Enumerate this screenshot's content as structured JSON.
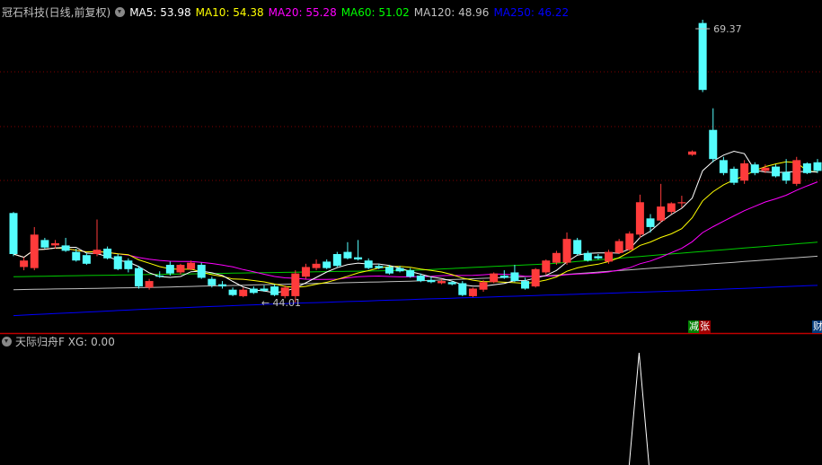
{
  "header": {
    "title": "冠石科技(日线,前复权)",
    "ma": [
      {
        "label": "MA5: 53.98",
        "color": "#ffffff"
      },
      {
        "label": "MA10: 54.38",
        "color": "#ffff00"
      },
      {
        "label": "MA20: 55.28",
        "color": "#ff00ff"
      },
      {
        "label": "MA60: 51.02",
        "color": "#00ff00"
      },
      {
        "label": "MA120: 48.96",
        "color": "#c0c0c0"
      },
      {
        "label": "MA250: 46.22",
        "color": "#0000ff"
      }
    ]
  },
  "price_axis": {
    "high": 69.37,
    "low": 44.01
  },
  "annotations": {
    "high_label": "69.37",
    "low_label": "← 44.01"
  },
  "colors": {
    "up": "#ff3b3b",
    "down": "#54fcfc",
    "grid": "#800000",
    "separator": "#c00000"
  },
  "candles": [
    [
      52.3,
      52.4,
      48.3,
      48.5
    ],
    [
      47.3,
      48.2,
      47.0,
      47.9
    ],
    [
      47.2,
      51.0,
      47.0,
      50.3
    ],
    [
      49.8,
      50.0,
      49.0,
      49.1
    ],
    [
      49.3,
      49.8,
      49.0,
      49.5
    ],
    [
      49.3,
      50.0,
      48.7,
      48.8
    ],
    [
      48.7,
      49.0,
      47.8,
      47.9
    ],
    [
      48.4,
      48.6,
      47.5,
      47.6
    ],
    [
      48.5,
      51.7,
      48.3,
      48.9
    ],
    [
      49.0,
      49.2,
      48.0,
      48.1
    ],
    [
      48.3,
      48.5,
      47.0,
      47.1
    ],
    [
      47.9,
      48.1,
      46.8,
      47.1
    ],
    [
      47.2,
      47.4,
      45.3,
      45.5
    ],
    [
      45.4,
      46.2,
      45.2,
      46.0
    ],
    [
      46.5,
      46.9,
      46.3,
      46.4
    ],
    [
      47.5,
      47.8,
      46.5,
      46.7
    ],
    [
      46.8,
      47.6,
      46.6,
      47.5
    ],
    [
      47.1,
      47.9,
      47.0,
      47.7
    ],
    [
      47.5,
      47.7,
      46.2,
      46.3
    ],
    [
      46.2,
      46.4,
      45.4,
      45.6
    ],
    [
      45.7,
      46.0,
      45.3,
      45.5
    ],
    [
      45.2,
      45.4,
      44.6,
      44.7
    ],
    [
      44.6,
      45.4,
      44.5,
      45.2
    ],
    [
      45.3,
      45.5,
      44.8,
      44.9
    ],
    [
      45.3,
      45.6,
      45.0,
      45.1
    ],
    [
      45.5,
      45.7,
      44.6,
      44.7
    ],
    [
      44.6,
      45.6,
      44.4,
      45.4
    ],
    [
      44.6,
      47.0,
      44.0,
      46.7
    ],
    [
      46.4,
      47.6,
      46.2,
      47.3
    ],
    [
      47.2,
      48.0,
      47.0,
      47.6
    ],
    [
      47.8,
      48.0,
      47.1,
      47.2
    ],
    [
      48.5,
      48.7,
      47.3,
      47.4
    ],
    [
      48.7,
      49.6,
      48.0,
      48.1
    ],
    [
      48.2,
      49.8,
      47.9,
      48.0
    ],
    [
      47.9,
      48.1,
      47.1,
      47.2
    ],
    [
      47.4,
      47.6,
      47.1,
      47.2
    ],
    [
      47.3,
      47.5,
      46.6,
      46.7
    ],
    [
      47.2,
      47.4,
      46.8,
      46.9
    ],
    [
      47.0,
      47.2,
      46.3,
      46.4
    ],
    [
      46.5,
      46.7,
      45.9,
      46.0
    ],
    [
      46.1,
      46.4,
      45.8,
      45.9
    ],
    [
      45.8,
      46.2,
      45.7,
      46.0
    ],
    [
      45.9,
      46.0,
      45.6,
      45.7
    ],
    [
      45.8,
      46.0,
      44.6,
      44.7
    ],
    [
      44.6,
      45.4,
      44.5,
      45.3
    ],
    [
      45.2,
      46.1,
      45.0,
      45.9
    ],
    [
      45.9,
      46.8,
      45.8,
      46.7
    ],
    [
      46.5,
      47.0,
      46.2,
      46.3
    ],
    [
      46.8,
      47.5,
      45.9,
      46.0
    ],
    [
      46.0,
      46.3,
      45.2,
      45.3
    ],
    [
      45.5,
      47.2,
      45.4,
      47.1
    ],
    [
      46.8,
      48.0,
      46.6,
      47.9
    ],
    [
      47.7,
      48.8,
      47.5,
      48.6
    ],
    [
      47.7,
      50.5,
      47.5,
      49.9
    ],
    [
      49.8,
      50.0,
      48.4,
      48.5
    ],
    [
      48.6,
      48.8,
      47.8,
      47.9
    ],
    [
      48.3,
      48.5,
      48.0,
      48.1
    ],
    [
      47.8,
      48.9,
      47.6,
      48.7
    ],
    [
      48.6,
      49.9,
      48.5,
      49.7
    ],
    [
      48.9,
      50.6,
      48.8,
      50.4
    ],
    [
      50.3,
      54.0,
      50.0,
      53.3
    ],
    [
      51.8,
      52.2,
      50.5,
      51.0
    ],
    [
      51.6,
      55.0,
      51.4,
      52.9
    ],
    [
      52.4,
      53.3,
      52.2,
      53.2
    ],
    [
      53.2,
      53.9,
      52.8,
      53.3
    ],
    [
      57.7,
      58.1,
      57.6,
      58.0
    ],
    [
      69.9,
      70.2,
      63.5,
      63.7
    ],
    [
      60.0,
      62.0,
      57.0,
      57.3
    ],
    [
      57.2,
      57.5,
      55.8,
      56.0
    ],
    [
      56.4,
      56.6,
      54.9,
      55.1
    ],
    [
      55.3,
      57.2,
      55.0,
      56.9
    ],
    [
      56.8,
      57.0,
      55.8,
      56.0
    ],
    [
      56.2,
      56.8,
      56.0,
      56.5
    ],
    [
      56.6,
      56.8,
      55.6,
      55.7
    ],
    [
      56.1,
      57.3,
      55.0,
      55.3
    ],
    [
      55.0,
      57.5,
      54.8,
      57.2
    ],
    [
      56.9,
      57.0,
      55.9,
      56.0
    ],
    [
      57.0,
      57.3,
      56.0,
      56.2
    ]
  ],
  "long_ma": {
    "ma60": [
      46.4,
      46.6,
      46.8,
      47.0,
      47.6,
      48.6,
      49.6
    ],
    "ma120": [
      45.2,
      45.4,
      45.7,
      46.0,
      46.5,
      47.4,
      48.3
    ],
    "ma250": [
      42.8,
      43.4,
      43.9,
      44.3,
      44.7,
      45.1,
      45.6
    ]
  },
  "bottom_tags": [
    {
      "text": "减",
      "bg": "#008000"
    },
    {
      "text": "张",
      "bg": "#a00000"
    },
    {
      "text": "财",
      "bg": "#003a7a"
    }
  ],
  "indicator": {
    "title": "天际归舟F",
    "value": "XG: 0.00",
    "signal_index": 60
  }
}
